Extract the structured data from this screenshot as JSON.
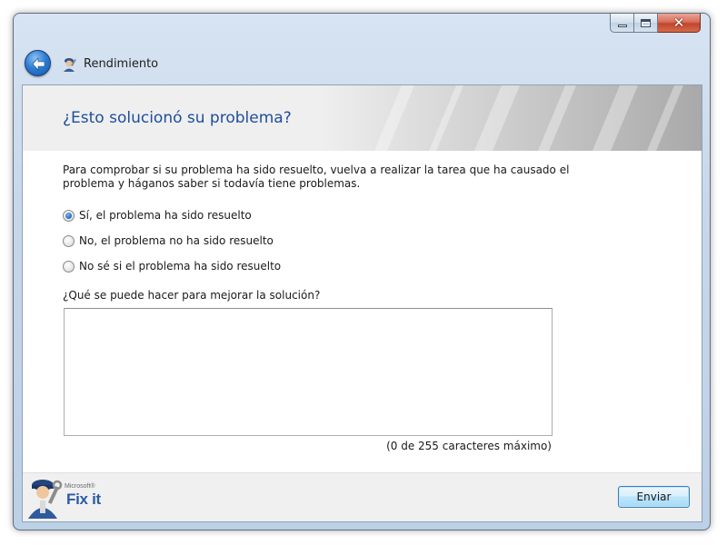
{
  "window": {
    "title": "Rendimiento",
    "close_glyph": "✕"
  },
  "page": {
    "heading": "¿Esto solucionó su problema?",
    "description": "Para comprobar si su problema ha sido resuelto, vuelva a realizar la tarea que ha causado el problema y háganos saber si todavía tiene problemas."
  },
  "options": [
    {
      "label": "Sí, el problema ha sido resuelto",
      "checked": true
    },
    {
      "label": "No, el problema no ha sido resuelto",
      "checked": false
    },
    {
      "label": "No sé si el problema ha sido resuelto",
      "checked": false
    }
  ],
  "feedback": {
    "label": "¿Qué se puede hacer para mejorar la solución?",
    "value": "",
    "counter": "(0 de 255 caracteres máximo)"
  },
  "footer": {
    "brand_small": "Microsoft®",
    "brand_name": "Fix it",
    "send_label": "Enviar"
  },
  "colors": {
    "heading": "#1e4e9c",
    "accent": "#3c7fb1",
    "close": "#c2452e"
  },
  "icons": {
    "back": "arrow-left-icon",
    "app": "technician-icon",
    "logo": "fixit-mascot-icon"
  }
}
